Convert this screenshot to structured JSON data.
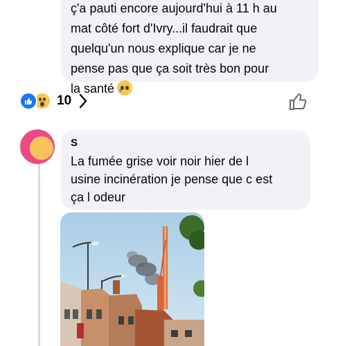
{
  "comment1": {
    "lines": [
      "ç'a pauti encore aujourd'hui à 11 h au",
      "mat côté fort d'Ivry...il faudrait que",
      "quelqu'un nous explique car je ne",
      "pense pas que ça soit très bon pour",
      "la santé"
    ],
    "emoji": "sad-tear-face-icon"
  },
  "reactions": {
    "count": "10",
    "icons": [
      "like-reaction-icon",
      "wow-reaction-icon"
    ]
  },
  "comment2": {
    "author": "S",
    "lines": [
      "La fumée grise voir noir hier de l",
      "usine incinération  je pense que c est",
      "ça l odeur"
    ],
    "photo": "smoke-over-crane-photo"
  },
  "colors": {
    "bubble": "#f0f2f5",
    "like_blue": "#1877f2",
    "text": "#050505",
    "avatar": "#ec4a86"
  }
}
